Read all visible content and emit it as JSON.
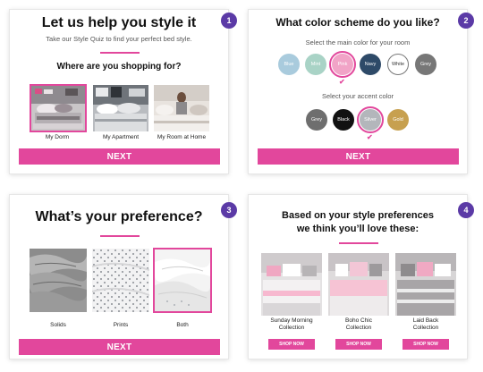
{
  "card1": {
    "step": "1",
    "title": "Let us help you style it",
    "subtitle": "Take our Style Quiz to find your perfect bed style.",
    "question": "Where are you shopping for?",
    "options": [
      {
        "label": "My Dorm",
        "selected": true
      },
      {
        "label": "My Apartment",
        "selected": false
      },
      {
        "label": "My Room at Home",
        "selected": false
      }
    ],
    "button": "NEXT"
  },
  "card2": {
    "step": "2",
    "title": "What color scheme do you like?",
    "main_label": "Select the main color for your room",
    "main_colors": [
      {
        "label": "Blue",
        "color": "#a9cbdd"
      },
      {
        "label": "Mint",
        "color": "#a9d3c6"
      },
      {
        "label": "Pink",
        "color": "#f1a4c7",
        "selected": true
      },
      {
        "label": "Navy",
        "color": "#2e4a68"
      },
      {
        "label": "White",
        "color": "#ffffff"
      },
      {
        "label": "Grey",
        "color": "#777777"
      }
    ],
    "accent_label": "Select your accent color",
    "accent_colors": [
      {
        "label": "Grey",
        "color": "#6e6e6e"
      },
      {
        "label": "Black",
        "color": "#111111"
      },
      {
        "label": "Silver",
        "color": "#b3b6bb",
        "selected": true
      },
      {
        "label": "Gold",
        "color": "#c7a04f"
      }
    ],
    "button": "NEXT"
  },
  "card3": {
    "step": "3",
    "title": "What’s your preference?",
    "options": [
      {
        "label": "Solids",
        "selected": false
      },
      {
        "label": "Prints",
        "selected": false
      },
      {
        "label": "Both",
        "selected": true
      }
    ],
    "button": "NEXT"
  },
  "card4": {
    "step": "4",
    "title_line1": "Based on your style preferences",
    "title_line2": "we think you’ll love these:",
    "products": [
      {
        "line1": "Sunday Morning",
        "line2": "Collection",
        "button": "SHOP NOW"
      },
      {
        "line1": "Boho Chic",
        "line2": "Collection",
        "button": "SHOP NOW"
      },
      {
        "line1": "Laid Back",
        "line2": "Collection",
        "button": "SHOP NOW"
      }
    ]
  },
  "colors": {
    "accent": "#e2479c",
    "step_badge": "#5b3aa6"
  }
}
